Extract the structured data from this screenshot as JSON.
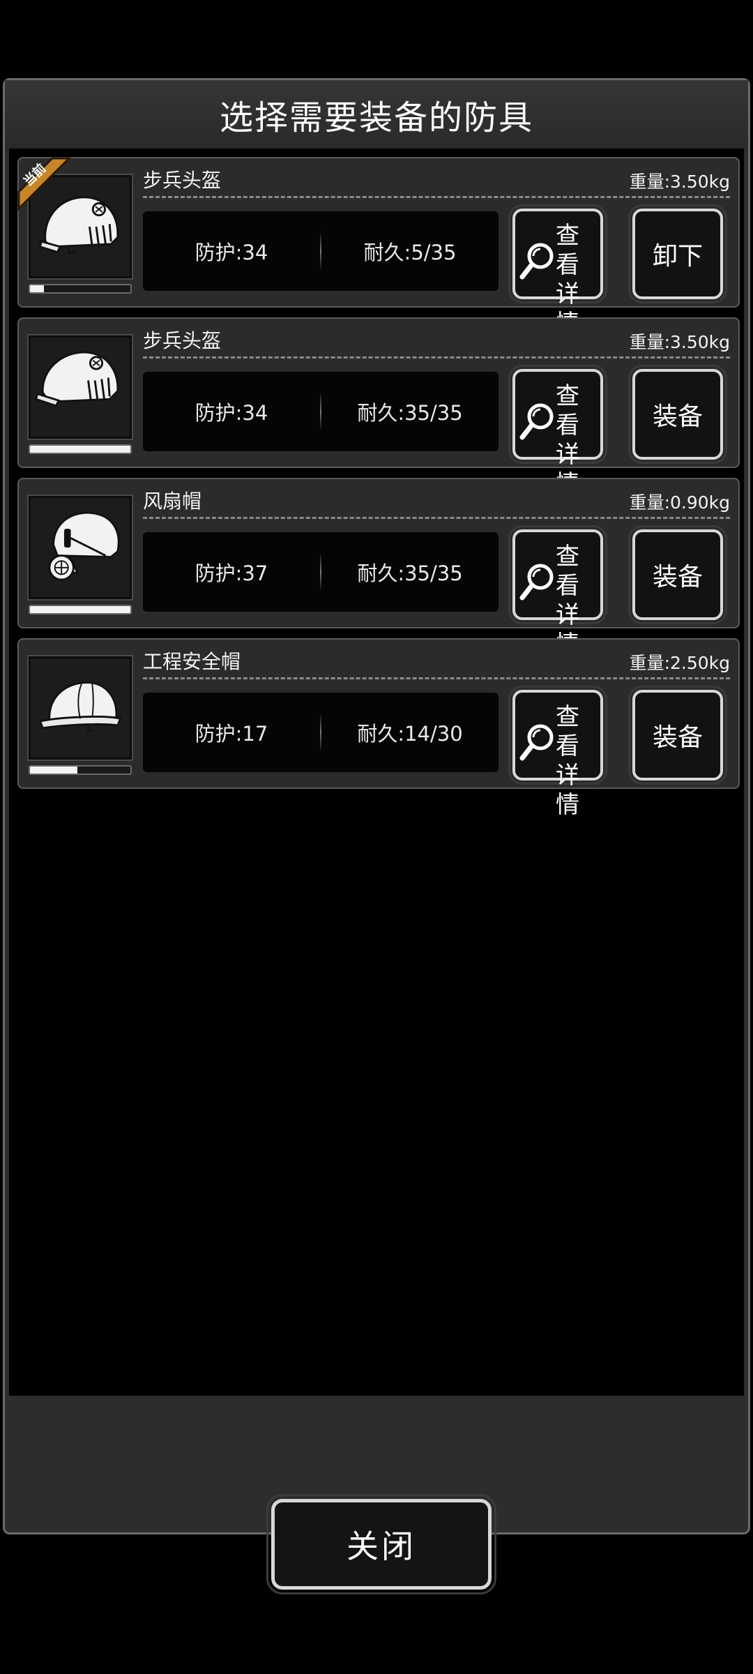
{
  "dialog": {
    "title": "选择需要装备的防具",
    "close_label": "关闭"
  },
  "current_badge": "当前",
  "detail_button": {
    "line1": "查看",
    "line2": "详情"
  },
  "items": [
    {
      "name": "步兵头盔",
      "weight": "重量:3.50kg",
      "protection": "防护:34",
      "durability": "耐久:5/35",
      "durability_fraction": 0.14,
      "action": "卸下",
      "current": true,
      "icon": "infantry-helmet-icon"
    },
    {
      "name": "步兵头盔",
      "weight": "重量:3.50kg",
      "protection": "防护:34",
      "durability": "耐久:35/35",
      "durability_fraction": 1.0,
      "action": "装备",
      "current": false,
      "icon": "infantry-helmet-icon"
    },
    {
      "name": "风扇帽",
      "weight": "重量:0.90kg",
      "protection": "防护:37",
      "durability": "耐久:35/35",
      "durability_fraction": 1.0,
      "action": "装备",
      "current": false,
      "icon": "fan-cap-icon"
    },
    {
      "name": "工程安全帽",
      "weight": "重量:2.50kg",
      "protection": "防护:17",
      "durability": "耐久:14/30",
      "durability_fraction": 0.47,
      "action": "装备",
      "current": false,
      "icon": "hard-hat-icon"
    }
  ],
  "colors": {
    "panel": "#2d2d2d",
    "badge": "#c8862a",
    "button_border": "#d8d8d8"
  }
}
